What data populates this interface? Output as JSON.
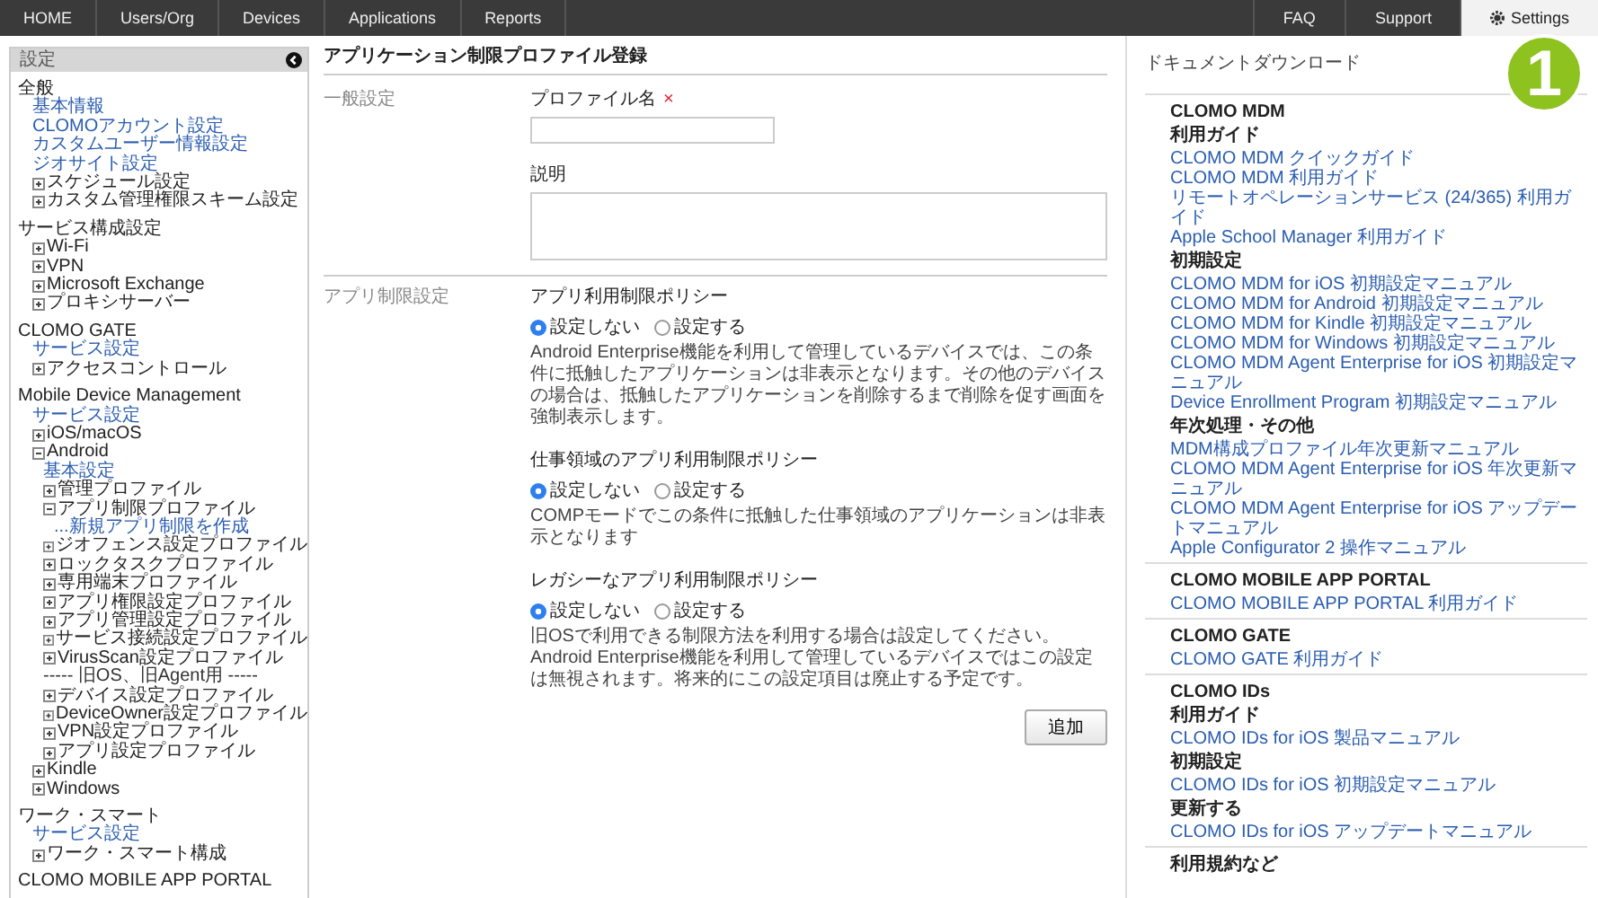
{
  "nav": {
    "left": [
      {
        "label": "HOME",
        "selected": false
      },
      {
        "label": "Users/Org",
        "selected": false
      },
      {
        "label": "Devices",
        "selected": false
      },
      {
        "label": "Applications",
        "selected": false
      },
      {
        "label": "Reports",
        "selected": false
      }
    ],
    "right": [
      {
        "label": "FAQ",
        "selected": false
      },
      {
        "label": "Support",
        "selected": false
      },
      {
        "label": "Settings",
        "selected": true
      }
    ],
    "badge": "1"
  },
  "sidebar": {
    "title": "設定",
    "groups": [
      {
        "title": "全般",
        "items": [
          {
            "label": "基本情報",
            "kind": "link"
          },
          {
            "label": "CLOMOアカウント設定",
            "kind": "link"
          },
          {
            "label": "カスタムユーザー情報設定",
            "kind": "link"
          },
          {
            "label": "ジオサイト設定",
            "kind": "link"
          },
          {
            "label": "スケジュール設定",
            "kind": "node",
            "expanded": false
          },
          {
            "label": "カスタム管理権限スキーム設定",
            "kind": "node",
            "expanded": false
          }
        ]
      },
      {
        "title": "サービス構成設定",
        "items": [
          {
            "label": "Wi-Fi",
            "kind": "node",
            "expanded": false
          },
          {
            "label": "VPN",
            "kind": "node",
            "expanded": false
          },
          {
            "label": "Microsoft Exchange",
            "kind": "node",
            "expanded": false
          },
          {
            "label": "プロキシサーバー",
            "kind": "node",
            "expanded": false
          }
        ]
      },
      {
        "title": "CLOMO GATE",
        "items": [
          {
            "label": "サービス設定",
            "kind": "link"
          },
          {
            "label": "アクセスコントロール",
            "kind": "node",
            "expanded": false
          }
        ]
      },
      {
        "title": "Mobile Device Management",
        "items": [
          {
            "label": "サービス設定",
            "kind": "link"
          },
          {
            "label": "iOS/macOS",
            "kind": "node",
            "expanded": false
          },
          {
            "label": "Android",
            "kind": "node",
            "expanded": true,
            "children": [
              {
                "label": "基本設定",
                "kind": "link"
              },
              {
                "label": "管理プロファイル",
                "kind": "node",
                "expanded": false
              },
              {
                "label": "アプリ制限プロファイル",
                "kind": "node",
                "expanded": true,
                "children": [
                  {
                    "label": "...新規アプリ制限を作成",
                    "kind": "link"
                  }
                ]
              },
              {
                "label": "ジオフェンス設定プロファイル",
                "kind": "node",
                "expanded": false
              },
              {
                "label": "ロックタスクプロファイル",
                "kind": "node",
                "expanded": false
              },
              {
                "label": "専用端末プロファイル",
                "kind": "node",
                "expanded": false
              },
              {
                "label": "アプリ権限設定プロファイル",
                "kind": "node",
                "expanded": false
              },
              {
                "label": "アプリ管理設定プロファイル",
                "kind": "node",
                "expanded": false
              },
              {
                "label": "サービス接続設定プロファイル",
                "kind": "node",
                "expanded": false
              },
              {
                "label": "VirusScan設定プロファイル",
                "kind": "node",
                "expanded": false
              },
              {
                "label": "----- 旧OS、旧Agent用 -----",
                "kind": "separator"
              },
              {
                "label": "デバイス設定プロファイル",
                "kind": "node",
                "expanded": false
              },
              {
                "label": "DeviceOwner設定プロファイル",
                "kind": "node",
                "expanded": false
              },
              {
                "label": "VPN設定プロファイル",
                "kind": "node",
                "expanded": false
              },
              {
                "label": "アプリ設定プロファイル",
                "kind": "node",
                "expanded": false
              }
            ]
          },
          {
            "label": "Kindle",
            "kind": "node",
            "expanded": false
          },
          {
            "label": "Windows",
            "kind": "node",
            "expanded": false
          }
        ]
      },
      {
        "title": "ワーク・スマート",
        "items": [
          {
            "label": "サービス設定",
            "kind": "link"
          },
          {
            "label": "ワーク・スマート構成",
            "kind": "node",
            "expanded": false
          }
        ]
      },
      {
        "title": "CLOMO MOBILE APP PORTAL"
      }
    ]
  },
  "form": {
    "title": "アプリケーション制限プロファイル登録",
    "general": {
      "label": "一般設定",
      "name_label": "プロファイル名",
      "required_mark": "×",
      "description_label": "説明"
    },
    "restriction": {
      "label": "アプリ制限設定",
      "policies": [
        {
          "title": "アプリ利用制限ポリシー",
          "options": [
            {
              "label": "設定しない",
              "selected": true
            },
            {
              "label": "設定する",
              "selected": false
            }
          ],
          "note": "Android Enterprise機能を利用して管理しているデバイスでは、この条件に抵触したアプリケーションは非表示となります。その他のデバイスの場合は、抵触したアプリケーションを削除するまで削除を促す画面を強制表示します。"
        },
        {
          "title": "仕事領域のアプリ利用制限ポリシー",
          "options": [
            {
              "label": "設定しない",
              "selected": true
            },
            {
              "label": "設定する",
              "selected": false
            }
          ],
          "note": "COMPモードでこの条件に抵触した仕事領域のアプリケーションは非表示となります"
        },
        {
          "title": "レガシーなアプリ利用制限ポリシー",
          "options": [
            {
              "label": "設定しない",
              "selected": true
            },
            {
              "label": "設定する",
              "selected": false
            }
          ],
          "note": "旧OSで利用できる制限方法を利用する場合は設定してください。Android Enterprise機能を利用して管理しているデバイスではこの設定は無視されます。将来的にこの設定項目は廃止する予定です。"
        }
      ]
    },
    "submit": "追加"
  },
  "docs": {
    "title": "ドキュメントダウンロード",
    "sections": [
      {
        "title": "CLOMO MDM",
        "entries": [
          {
            "kind": "subheading",
            "label": "利用ガイド"
          },
          {
            "kind": "link",
            "label": "CLOMO MDM クイックガイド"
          },
          {
            "kind": "link",
            "label": "CLOMO MDM 利用ガイド"
          },
          {
            "kind": "link",
            "label": "リモートオペレーションサービス (24/365) 利用ガイド"
          },
          {
            "kind": "link",
            "label": "Apple School Manager 利用ガイド"
          },
          {
            "kind": "subheading",
            "label": "初期設定"
          },
          {
            "kind": "link",
            "label": "CLOMO MDM for iOS 初期設定マニュアル"
          },
          {
            "kind": "link",
            "label": "CLOMO MDM for Android 初期設定マニュアル"
          },
          {
            "kind": "link",
            "label": "CLOMO MDM for Kindle 初期設定マニュアル"
          },
          {
            "kind": "link",
            "label": "CLOMO MDM for Windows 初期設定マニュアル"
          },
          {
            "kind": "link",
            "label": "CLOMO MDM Agent Enterprise for iOS 初期設定マニュアル"
          },
          {
            "kind": "link",
            "label": "Device Enrollment Program 初期設定マニュアル"
          },
          {
            "kind": "subheading",
            "label": "年次処理・その他"
          },
          {
            "kind": "link",
            "label": "MDM構成プロファイル年次更新マニュアル"
          },
          {
            "kind": "link",
            "label": "CLOMO MDM Agent Enterprise for iOS 年次更新マニュアル"
          },
          {
            "kind": "link",
            "label": "CLOMO MDM Agent Enterprise for iOS アップデートマニュアル"
          },
          {
            "kind": "link",
            "label": "Apple Configurator 2 操作マニュアル"
          }
        ]
      },
      {
        "title": "CLOMO MOBILE APP PORTAL",
        "entries": [
          {
            "kind": "link",
            "label": "CLOMO MOBILE APP PORTAL 利用ガイド"
          }
        ]
      },
      {
        "title": "CLOMO GATE",
        "entries": [
          {
            "kind": "link",
            "label": "CLOMO GATE 利用ガイド"
          }
        ]
      },
      {
        "title": "CLOMO IDs",
        "entries": [
          {
            "kind": "subheading",
            "label": "利用ガイド"
          },
          {
            "kind": "link",
            "label": "CLOMO IDs for iOS 製品マニュアル"
          },
          {
            "kind": "subheading",
            "label": "初期設定"
          },
          {
            "kind": "link",
            "label": "CLOMO IDs for iOS 初期設定マニュアル"
          },
          {
            "kind": "subheading",
            "label": "更新する"
          },
          {
            "kind": "link",
            "label": "CLOMO IDs for iOS アップデートマニュアル"
          }
        ]
      },
      {
        "title": "利用規約など"
      }
    ]
  }
}
